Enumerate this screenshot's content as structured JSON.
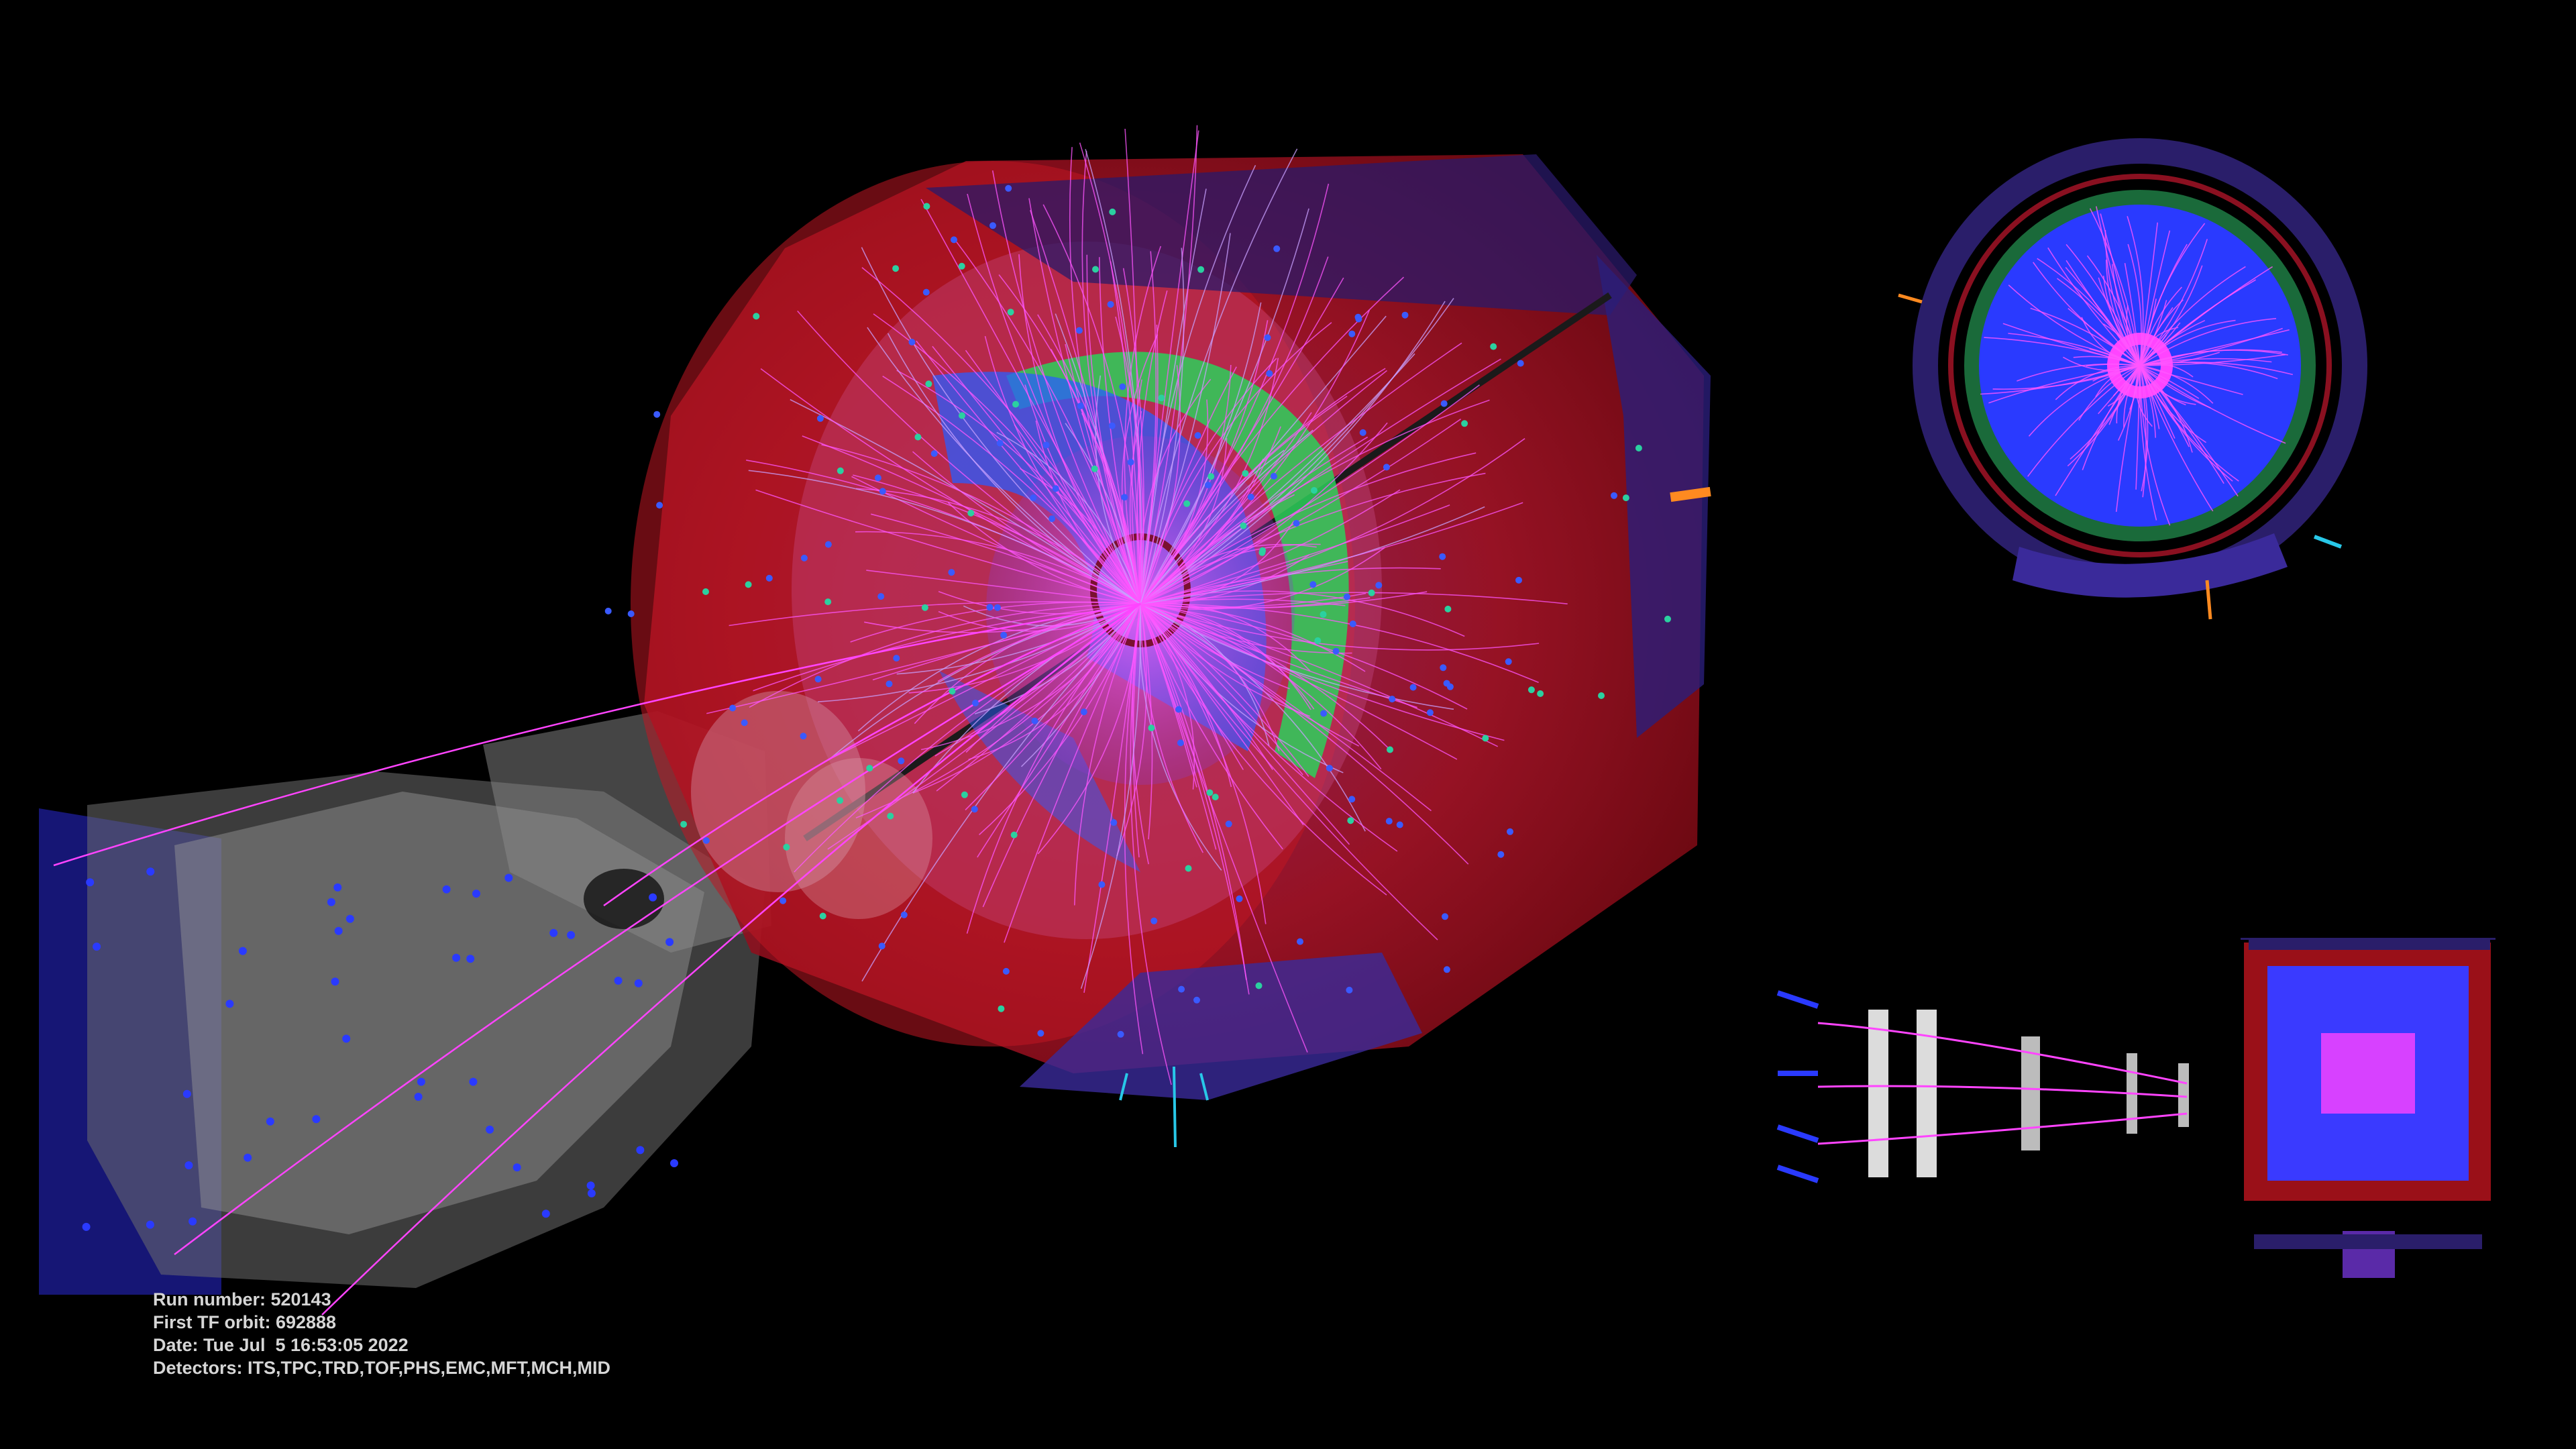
{
  "event_info": {
    "run_number": "Run number: 520143",
    "first_tf_orbit": "First TF orbit: 692888",
    "date": "Date: Tue Jul  5 16:53:05 2022",
    "detectors": "Detectors: ITS,TPC,TRD,TOF,PHS,EMC,MFT,MCH,MID"
  },
  "colors": {
    "background": "#000000",
    "tof_red": "#c0101a",
    "trd_green": "#2bd05a",
    "tpc_blue": "#2a5cff",
    "tracks_magenta": "#ff44ff",
    "emcal_purple": "#3a2a9a",
    "muon_gray": "#8a8a8a",
    "cyan_hits": "#28c8e8",
    "orange_hits": "#ff8a20"
  }
}
